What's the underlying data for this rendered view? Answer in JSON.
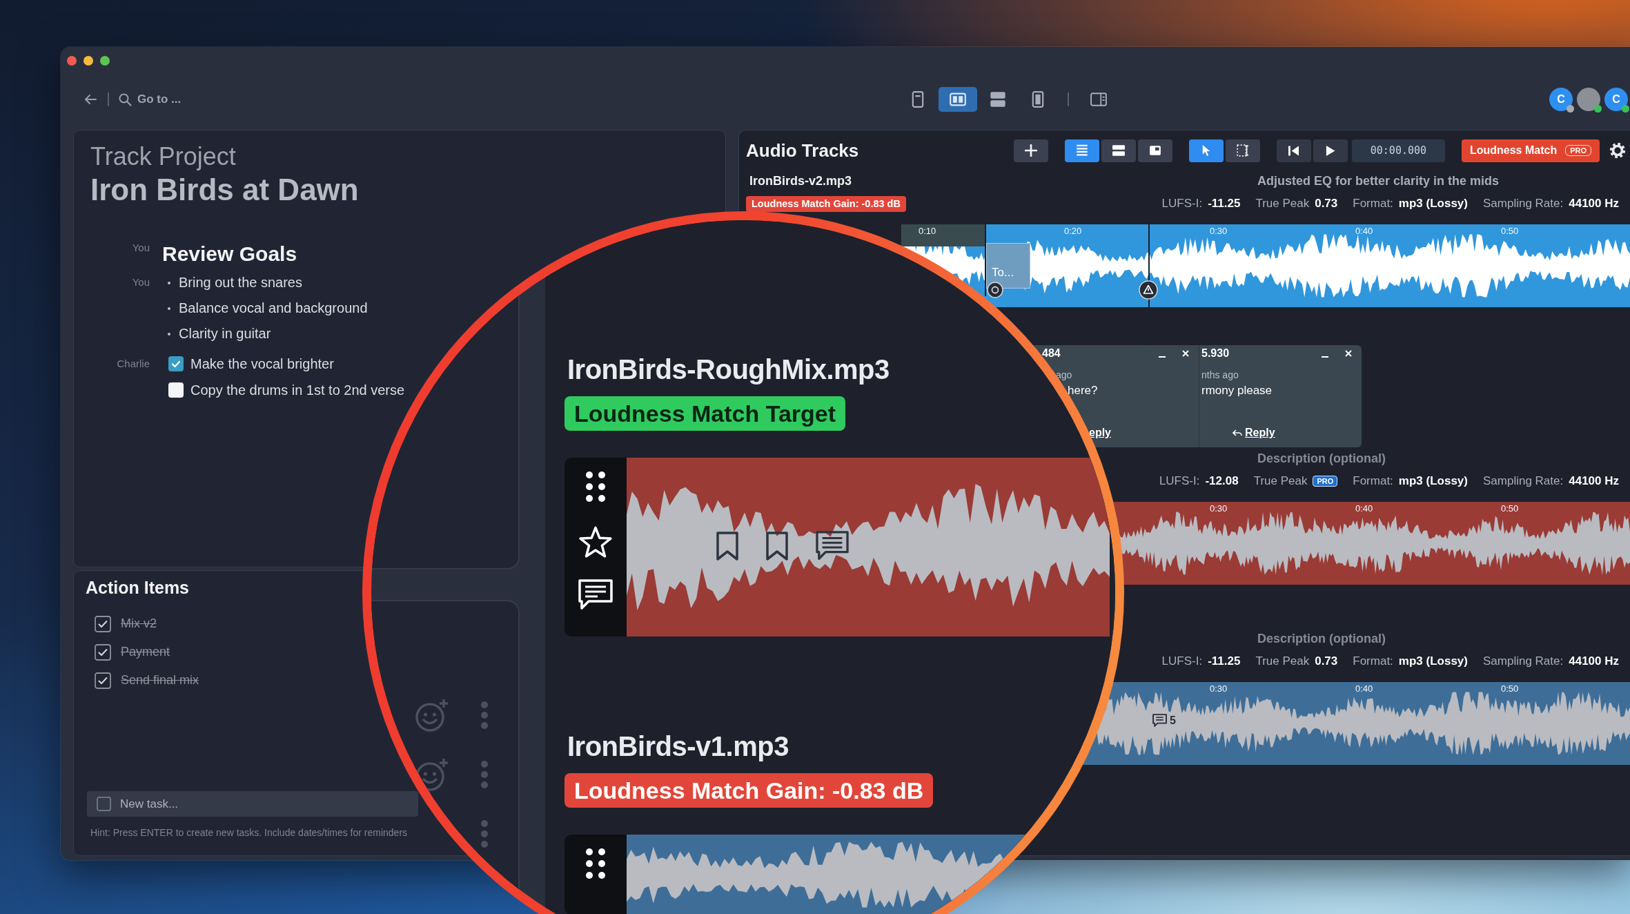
{
  "toolbar": {
    "search": {
      "placeholder": "Go to ..."
    },
    "layouts": [
      {
        "selected": false
      },
      {
        "selected": true
      },
      {
        "selected": false
      },
      {
        "selected": false
      }
    ],
    "avatars": [
      {
        "kind": "initial",
        "initial": "C",
        "online": false
      },
      {
        "kind": "photo",
        "online": true
      },
      {
        "kind": "initial",
        "initial": "C",
        "online": true
      }
    ]
  },
  "project": {
    "label": "Track Project",
    "title": "Iron Birds at Dawn",
    "blocks": [
      {
        "kind": "heading",
        "author": "You",
        "text": "Review Goals"
      },
      {
        "kind": "bullets",
        "author": "You",
        "items": [
          "Bring out the snares",
          "Balance vocal and background",
          "Clarity in guitar"
        ]
      },
      {
        "kind": "tasks",
        "author": "Charlie",
        "items": [
          {
            "text": "Make the vocal brighter",
            "checked": true
          },
          {
            "text": "Copy the drums in 1st to 2nd verse",
            "checked": false
          }
        ]
      }
    ]
  },
  "action_items": {
    "title": "Action Items",
    "items": [
      {
        "text": "Mix v2",
        "checked": true
      },
      {
        "text": "Payment",
        "checked": true
      },
      {
        "text": "Send final mix",
        "checked": true
      }
    ],
    "new_task": {
      "placeholder": "New task..."
    },
    "hint": "Hint: Press ENTER to create new tasks. Include dates/times for reminders"
  },
  "audio_tracks": {
    "title": "Audio Tracks",
    "views": [
      {
        "selected": true
      },
      {
        "selected": false
      },
      {
        "selected": false
      }
    ],
    "tools": [
      {
        "selected": true
      },
      {
        "selected": false
      }
    ],
    "time": "00:00.000",
    "loudness_button": {
      "label": "Loudness Match",
      "badge": "PRO"
    },
    "tracks": [
      {
        "name": "IronBirds-v2.mp3",
        "badge": {
          "kind": "gain",
          "label": "Loudness Match Gain: -0.83 dB"
        },
        "description": {
          "value": "Adjusted EQ for better clarity in the mids"
        },
        "stats": [
          {
            "kind": "value",
            "label": "LUFS-I:",
            "value": "-11.25"
          },
          {
            "kind": "value",
            "label": "True Peak",
            "value": "0.73"
          },
          {
            "kind": "value",
            "label": "Format:",
            "value": "mp3 (Lossy)"
          },
          {
            "kind": "value",
            "label": "Sampling Rate:",
            "value": "44100 Hz"
          }
        ],
        "selected": true,
        "color": "#3197dc",
        "ticks": [
          "0:10",
          "0:20",
          "0:30",
          "0:40",
          "0:50"
        ],
        "region_label": "To..."
      },
      {
        "description": {
          "placeholder": "Description (optional)"
        },
        "stats": [
          {
            "kind": "value",
            "label": "LUFS-I:",
            "value": "-12.08"
          },
          {
            "kind": "badge",
            "label": "True Peak",
            "value": "PRO"
          },
          {
            "kind": "value",
            "label": "Format:",
            "value": "mp3 (Lossy)"
          },
          {
            "kind": "value",
            "label": "Sampling Rate:",
            "value": "44100 Hz"
          }
        ],
        "selected": false,
        "color": "#9a3b36",
        "ticks": [
          "0:30",
          "0:40",
          "0:50"
        ]
      },
      {
        "description": {
          "placeholder": "Description (optional)"
        },
        "stats": [
          {
            "kind": "value",
            "label": "LUFS-I:",
            "value": "-11.25"
          },
          {
            "kind": "value",
            "label": "True Peak",
            "value": "0.73"
          },
          {
            "kind": "value",
            "label": "Format:",
            "value": "mp3 (Lossy)"
          },
          {
            "kind": "value",
            "label": "Sampling Rate:",
            "value": "44100 Hz"
          }
        ],
        "selected": false,
        "color": "#3e6e98",
        "ticks": [
          "0:30",
          "0:40",
          "0:50"
        ],
        "comment_count": "5"
      }
    ],
    "comments": [
      {
        "header": "484",
        "time": "ago",
        "text": "here?",
        "reply": "eply"
      },
      {
        "header": "5.930",
        "time": "nths ago",
        "text": "rmony please",
        "reply": "Reply",
        "reply_icon": true
      }
    ]
  },
  "magnifier": {
    "tracks": [
      {
        "name": "IronBirds-RoughMix.mp3",
        "badge": {
          "kind": "target",
          "label": "Loudness Match Target"
        },
        "color": "#9a3b36",
        "starred": false,
        "markers": [
          {
            "kind": "bookmark"
          },
          {
            "kind": "bookmark"
          },
          {
            "kind": "comment"
          }
        ]
      },
      {
        "name": "IronBirds-v1.mp3",
        "badge": {
          "kind": "gain",
          "label": "Loudness Match Gain: -0.83 dB"
        },
        "color": "#3e6e98"
      }
    ]
  }
}
